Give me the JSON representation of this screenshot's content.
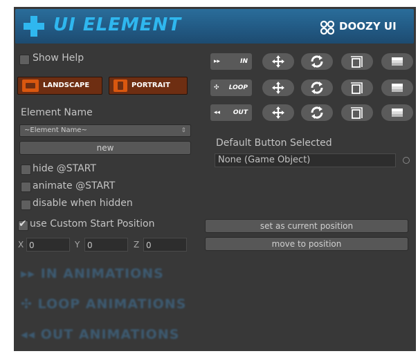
{
  "header": {
    "title": "UI ELEMENT",
    "logo_text": "DOOZY UI",
    "title_color": "#2fb7ef",
    "background_color": "#225a84"
  },
  "left": {
    "show_help": {
      "label": "Show Help",
      "checked": false
    },
    "orientation": {
      "landscape_label": "LANDSCAPE",
      "portrait_label": "PORTRAIT",
      "accent_color": "#d9570f"
    },
    "element_name": {
      "label": "Element Name",
      "selected": "~Element Name~",
      "new_label": "new"
    },
    "options": [
      {
        "label": "hide @START",
        "checked": false
      },
      {
        "label": "animate @START",
        "checked": false
      },
      {
        "label": "disable when hidden",
        "checked": false
      }
    ],
    "custom_start": {
      "label": "use Custom Start Position",
      "checked": true
    },
    "position": {
      "x_label": "X",
      "x_value": "0",
      "y_label": "Y",
      "y_value": "0",
      "z_label": "Z",
      "z_value": "0"
    },
    "sections": [
      {
        "label": "▸▸ IN ANIMATIONS"
      },
      {
        "label": "✣ LOOP ANIMATIONS"
      },
      {
        "label": "◂◂ OUT ANIMATIONS"
      }
    ]
  },
  "right": {
    "rows": [
      {
        "icon": "fast-forward-icon",
        "glyph": "▸▸",
        "label": "IN"
      },
      {
        "icon": "loop-arrows-icon",
        "glyph": "✣",
        "label": "LOOP"
      },
      {
        "icon": "rewind-icon",
        "glyph": "◂◂",
        "label": "OUT"
      }
    ],
    "row_icons": [
      "move-icon",
      "rotate-icon",
      "scale-icon",
      "fade-icon"
    ],
    "default_button": {
      "label": "Default Button Selected",
      "value": "None (Game Object)"
    },
    "set_position_label": "set as current position",
    "move_position_label": "move to position"
  }
}
